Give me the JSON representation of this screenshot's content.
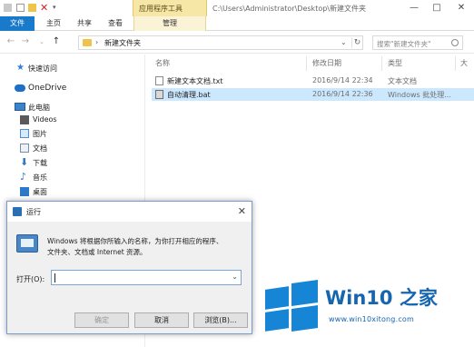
{
  "window": {
    "context_tab_label": "应用程序工具",
    "title_path": "C:\\Users\\Administrator\\Desktop\\新建文件夹",
    "minimize": "—",
    "maximize": "□",
    "close": "✕"
  },
  "ribbon": {
    "tabs": [
      "文件",
      "主页",
      "共享",
      "查看",
      "管理"
    ]
  },
  "address": {
    "separator": "›",
    "current_folder": "新建文件夹",
    "search_placeholder": "搜索\"新建文件夹\"",
    "back": "←",
    "forward": "→",
    "up": "↑",
    "chevron": "⌄",
    "refresh": "↻"
  },
  "sidebar": {
    "items": [
      {
        "label": "快速访问",
        "icon": "star-icon",
        "color": "#2f7fd4"
      },
      {
        "label": "OneDrive",
        "icon": "cloud-icon",
        "color": "#1f6fc9"
      },
      {
        "label": "此电脑",
        "icon": "computer-icon",
        "color": "#3b84c9"
      },
      {
        "label": "Videos",
        "icon": "videos-icon",
        "color": "#5a5a5a"
      },
      {
        "label": "图片",
        "icon": "pictures-icon",
        "color": "#4d8fcf"
      },
      {
        "label": "文档",
        "icon": "documents-icon",
        "color": "#7a8da3"
      },
      {
        "label": "下载",
        "icon": "downloads-icon",
        "color": "#2e78c8"
      },
      {
        "label": "音乐",
        "icon": "music-icon",
        "color": "#2e78c8"
      },
      {
        "label": "桌面",
        "icon": "desktop-icon",
        "color": "#2e78c8"
      }
    ]
  },
  "filelist": {
    "columns": [
      "名称",
      "修改日期",
      "类型",
      "大"
    ],
    "files": [
      {
        "name": "新建文本文档.txt",
        "date": "2016/9/14 22:34",
        "type": "文本文档",
        "selected": false
      },
      {
        "name": "自动清理.bat",
        "date": "2016/9/14 22:36",
        "type": "Windows 批处理...",
        "selected": true
      }
    ]
  },
  "run_dialog": {
    "title": "运行",
    "close": "✕",
    "description_line1": "Windows 将根据你所输入的名称，为你打开相应的程序、",
    "description_line2": "文件夹、文档或 Internet 资源。",
    "open_label": "打开(O):",
    "open_value": "",
    "dropdown": "⌄",
    "ok_label": "确定",
    "cancel_label": "取消",
    "browse_label": "浏览(B)..."
  },
  "watermark": {
    "brand": "Win10 之家",
    "url": "www.win10xitong.com",
    "color": "#1685d6"
  }
}
